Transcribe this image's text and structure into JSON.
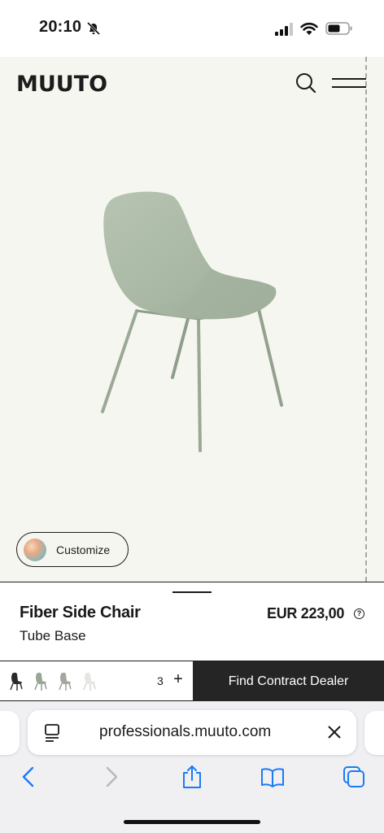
{
  "status_bar": {
    "time": "20:10",
    "icons": [
      "bell-slash-icon",
      "cellular-signal-icon",
      "wifi-icon",
      "battery-icon"
    ]
  },
  "header": {
    "logo": "MUUTO",
    "icons": [
      "search-icon",
      "hamburger-menu-icon"
    ]
  },
  "hero": {
    "product_image": "fiber-side-chair-dusty-green",
    "customize_label": "Customize"
  },
  "product": {
    "name": "Fiber Side Chair",
    "subtitle": "Tube Base",
    "price": "EUR 223,00",
    "price_info_glyph": "?"
  },
  "action_bar": {
    "color_swatches": [
      "black",
      "grey-green",
      "grey",
      "white"
    ],
    "swatch_count": "3",
    "plus_label": "+",
    "cta_label": "Find Contract Dealer"
  },
  "browser": {
    "url": "professionals.muuto.com",
    "icons": [
      "reader-mode-icon",
      "close-icon",
      "back-icon",
      "forward-icon",
      "share-icon",
      "bookmarks-icon",
      "tabs-icon"
    ]
  },
  "colors": {
    "hero_bg": "#f6f6f1",
    "chair_green": "#a9b8a4",
    "cta_bg": "#252525",
    "ios_blue": "#1a7cf5"
  }
}
